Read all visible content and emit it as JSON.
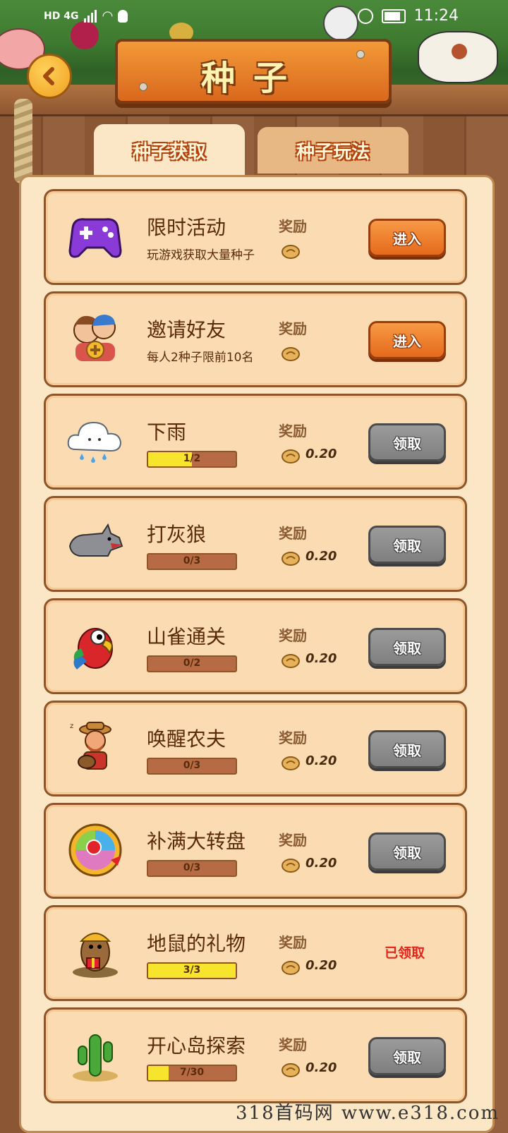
{
  "status_bar": {
    "network": "HD 4G",
    "time": "11:24"
  },
  "header": {
    "title": "种子"
  },
  "tabs": [
    {
      "label": "种子获取",
      "active": true
    },
    {
      "label": "种子玩法",
      "active": false
    }
  ],
  "reward_label": "奖励",
  "tasks": [
    {
      "icon": "gamepad-icon",
      "name": "限时活动",
      "desc": "玩游戏获取大量种子",
      "reward": "",
      "button": "进入",
      "button_style": "orange"
    },
    {
      "icon": "invite-friends-icon",
      "name": "邀请好友",
      "desc": "每人2种子限前10名",
      "reward": "",
      "button": "进入",
      "button_style": "orange"
    },
    {
      "icon": "rain-cloud-icon",
      "name": "下雨",
      "progress": "1/2",
      "progress_ratio": 0.5,
      "reward": "0.20",
      "button": "领取",
      "button_style": "gray"
    },
    {
      "icon": "wolf-icon",
      "name": "打灰狼",
      "progress": "0/3",
      "progress_ratio": 0,
      "reward": "0.20",
      "button": "领取",
      "button_style": "gray"
    },
    {
      "icon": "parrot-icon",
      "name": "山雀通关",
      "progress": "0/2",
      "progress_ratio": 0,
      "reward": "0.20",
      "button": "领取",
      "button_style": "gray"
    },
    {
      "icon": "farmer-icon",
      "name": "唤醒农夫",
      "progress": "0/3",
      "progress_ratio": 0,
      "reward": "0.20",
      "button": "领取",
      "button_style": "gray"
    },
    {
      "icon": "wheel-icon",
      "name": "补满大转盘",
      "progress": "0/3",
      "progress_ratio": 0,
      "reward": "0.20",
      "button": "领取",
      "button_style": "gray"
    },
    {
      "icon": "gopher-icon",
      "name": "地鼠的礼物",
      "progress": "3/3",
      "progress_ratio": 1,
      "reward": "0.20",
      "claimed_text": "已领取"
    },
    {
      "icon": "cactus-icon",
      "name": "开心岛探索",
      "progress": "7/30",
      "progress_ratio": 0.233,
      "reward": "0.20",
      "button": "领取",
      "button_style": "gray"
    }
  ],
  "watermark": "318首码网 www.e318.com"
}
